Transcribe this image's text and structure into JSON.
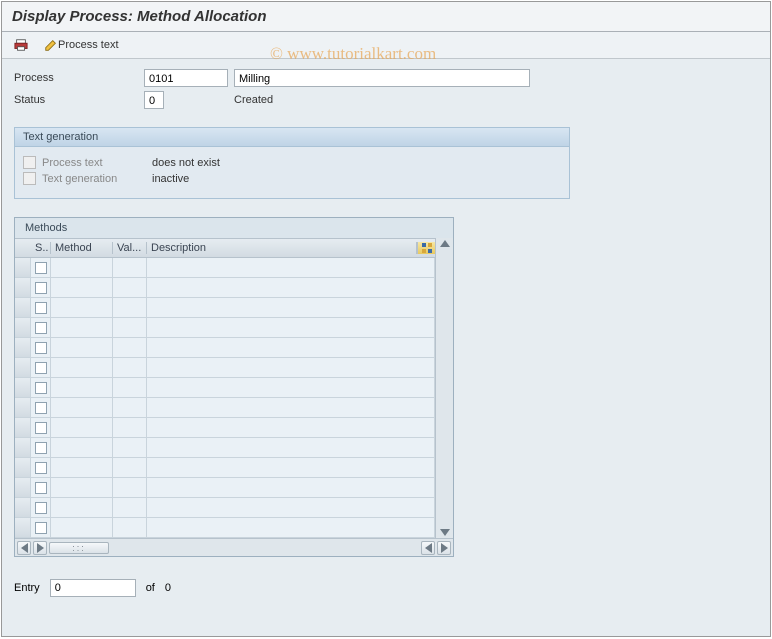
{
  "title": "Display Process: Method Allocation",
  "toolbar": {
    "print_icon": "print-icon",
    "process_text_label": "Process text"
  },
  "header": {
    "process_label": "Process",
    "process_code": "0101",
    "process_name": "Milling",
    "status_label": "Status",
    "status_code": "0",
    "status_text": "Created"
  },
  "text_generation": {
    "title": "Text generation",
    "row1_label": "Process text",
    "row1_value": "does not exist",
    "row2_label": "Text generation",
    "row2_value": "inactive"
  },
  "methods": {
    "title": "Methods",
    "columns": {
      "s": "S..",
      "method": "Method",
      "val": "Val...",
      "desc": "Description"
    },
    "row_count": 14
  },
  "footer": {
    "entry_label": "Entry",
    "entry_value": "0",
    "of_label": "of",
    "of_value": "0"
  },
  "watermark": "© www.tutorialkart.com"
}
